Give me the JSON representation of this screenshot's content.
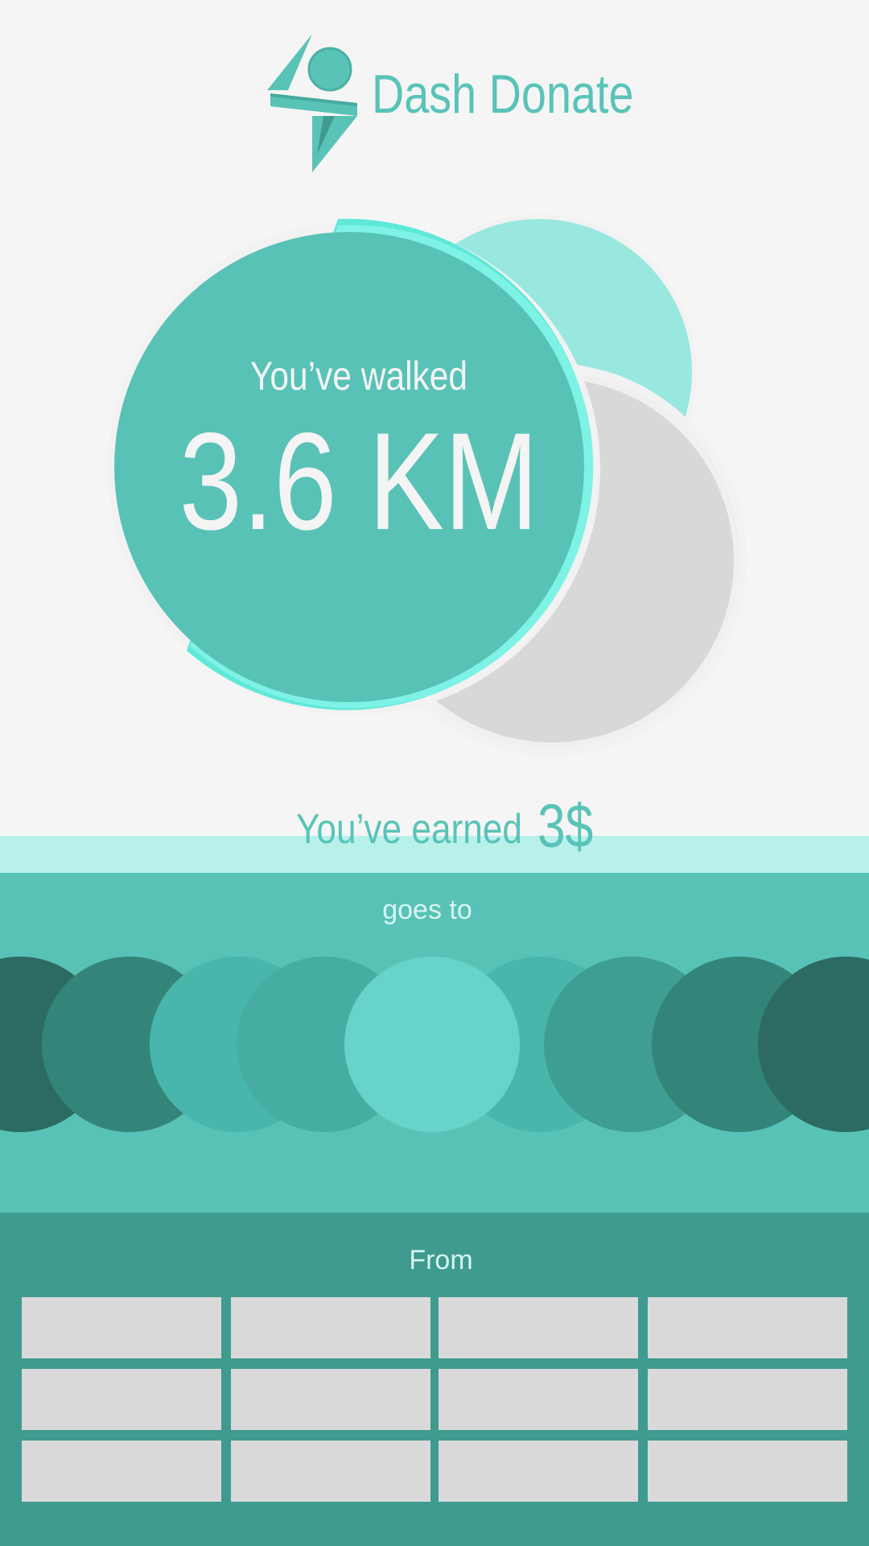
{
  "app": {
    "title": "Dash Donate"
  },
  "stats": {
    "walked_label": "You’ve walked",
    "distance": "3.6 KM",
    "earned_label": "You’ve earned",
    "earned_value": "3$"
  },
  "charity_section": {
    "label": "goes to",
    "items": [
      {
        "color": "#2b6b63"
      },
      {
        "color": "#33857a"
      },
      {
        "color": "#48b6ab"
      },
      {
        "color": "#45ada1"
      },
      {
        "color": "#68d3c8"
      },
      {
        "color": "#48b6ab"
      },
      {
        "color": "#3f9e93"
      },
      {
        "color": "#33857a"
      },
      {
        "color": "#2b6b63"
      }
    ]
  },
  "donor_section": {
    "label": "From",
    "tile_count": 12
  },
  "colors": {
    "brand": "#59c3b8",
    "accent_ring": "#5ee8d8",
    "light_mint": "#98e8df",
    "band": "#b7f1ea",
    "section_mid": "#58c2b7",
    "section_dark": "#3f9a8f",
    "placeholder": "#d9d9d9"
  }
}
